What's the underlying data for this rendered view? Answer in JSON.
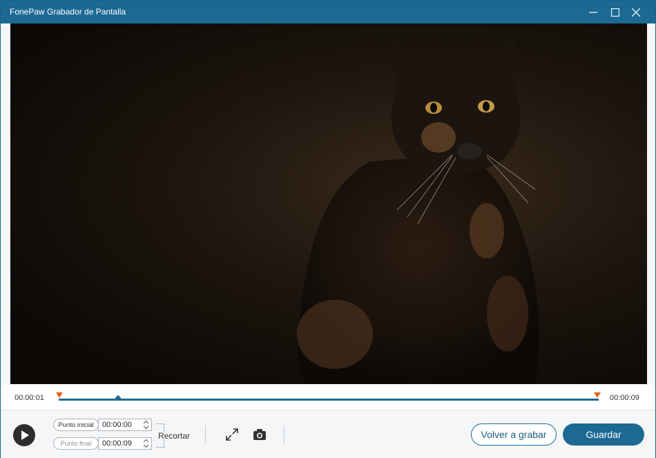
{
  "app": {
    "title": "FonePaw Grabador de Pantalla"
  },
  "window_controls": {
    "minimize_icon": "minimize-icon",
    "maximize_icon": "maximize-icon",
    "close_icon": "close-icon"
  },
  "timeline": {
    "start_time": "00:00:01",
    "end_time": "00:00:09",
    "playhead_progress": 0.11
  },
  "trim": {
    "start_label": "Punto inicial",
    "start_value": "00:00:00",
    "end_label": "Punto final",
    "end_value": "00:00:09",
    "cut_label": "Recortar"
  },
  "tools": {
    "fullscreen_icon": "expand-icon",
    "snapshot_icon": "camera-icon"
  },
  "actions": {
    "rerecord_label": "Volver a grabar",
    "save_label": "Guardar"
  },
  "colors": {
    "accent": "#1c6a93",
    "marker": "#e8621c"
  }
}
